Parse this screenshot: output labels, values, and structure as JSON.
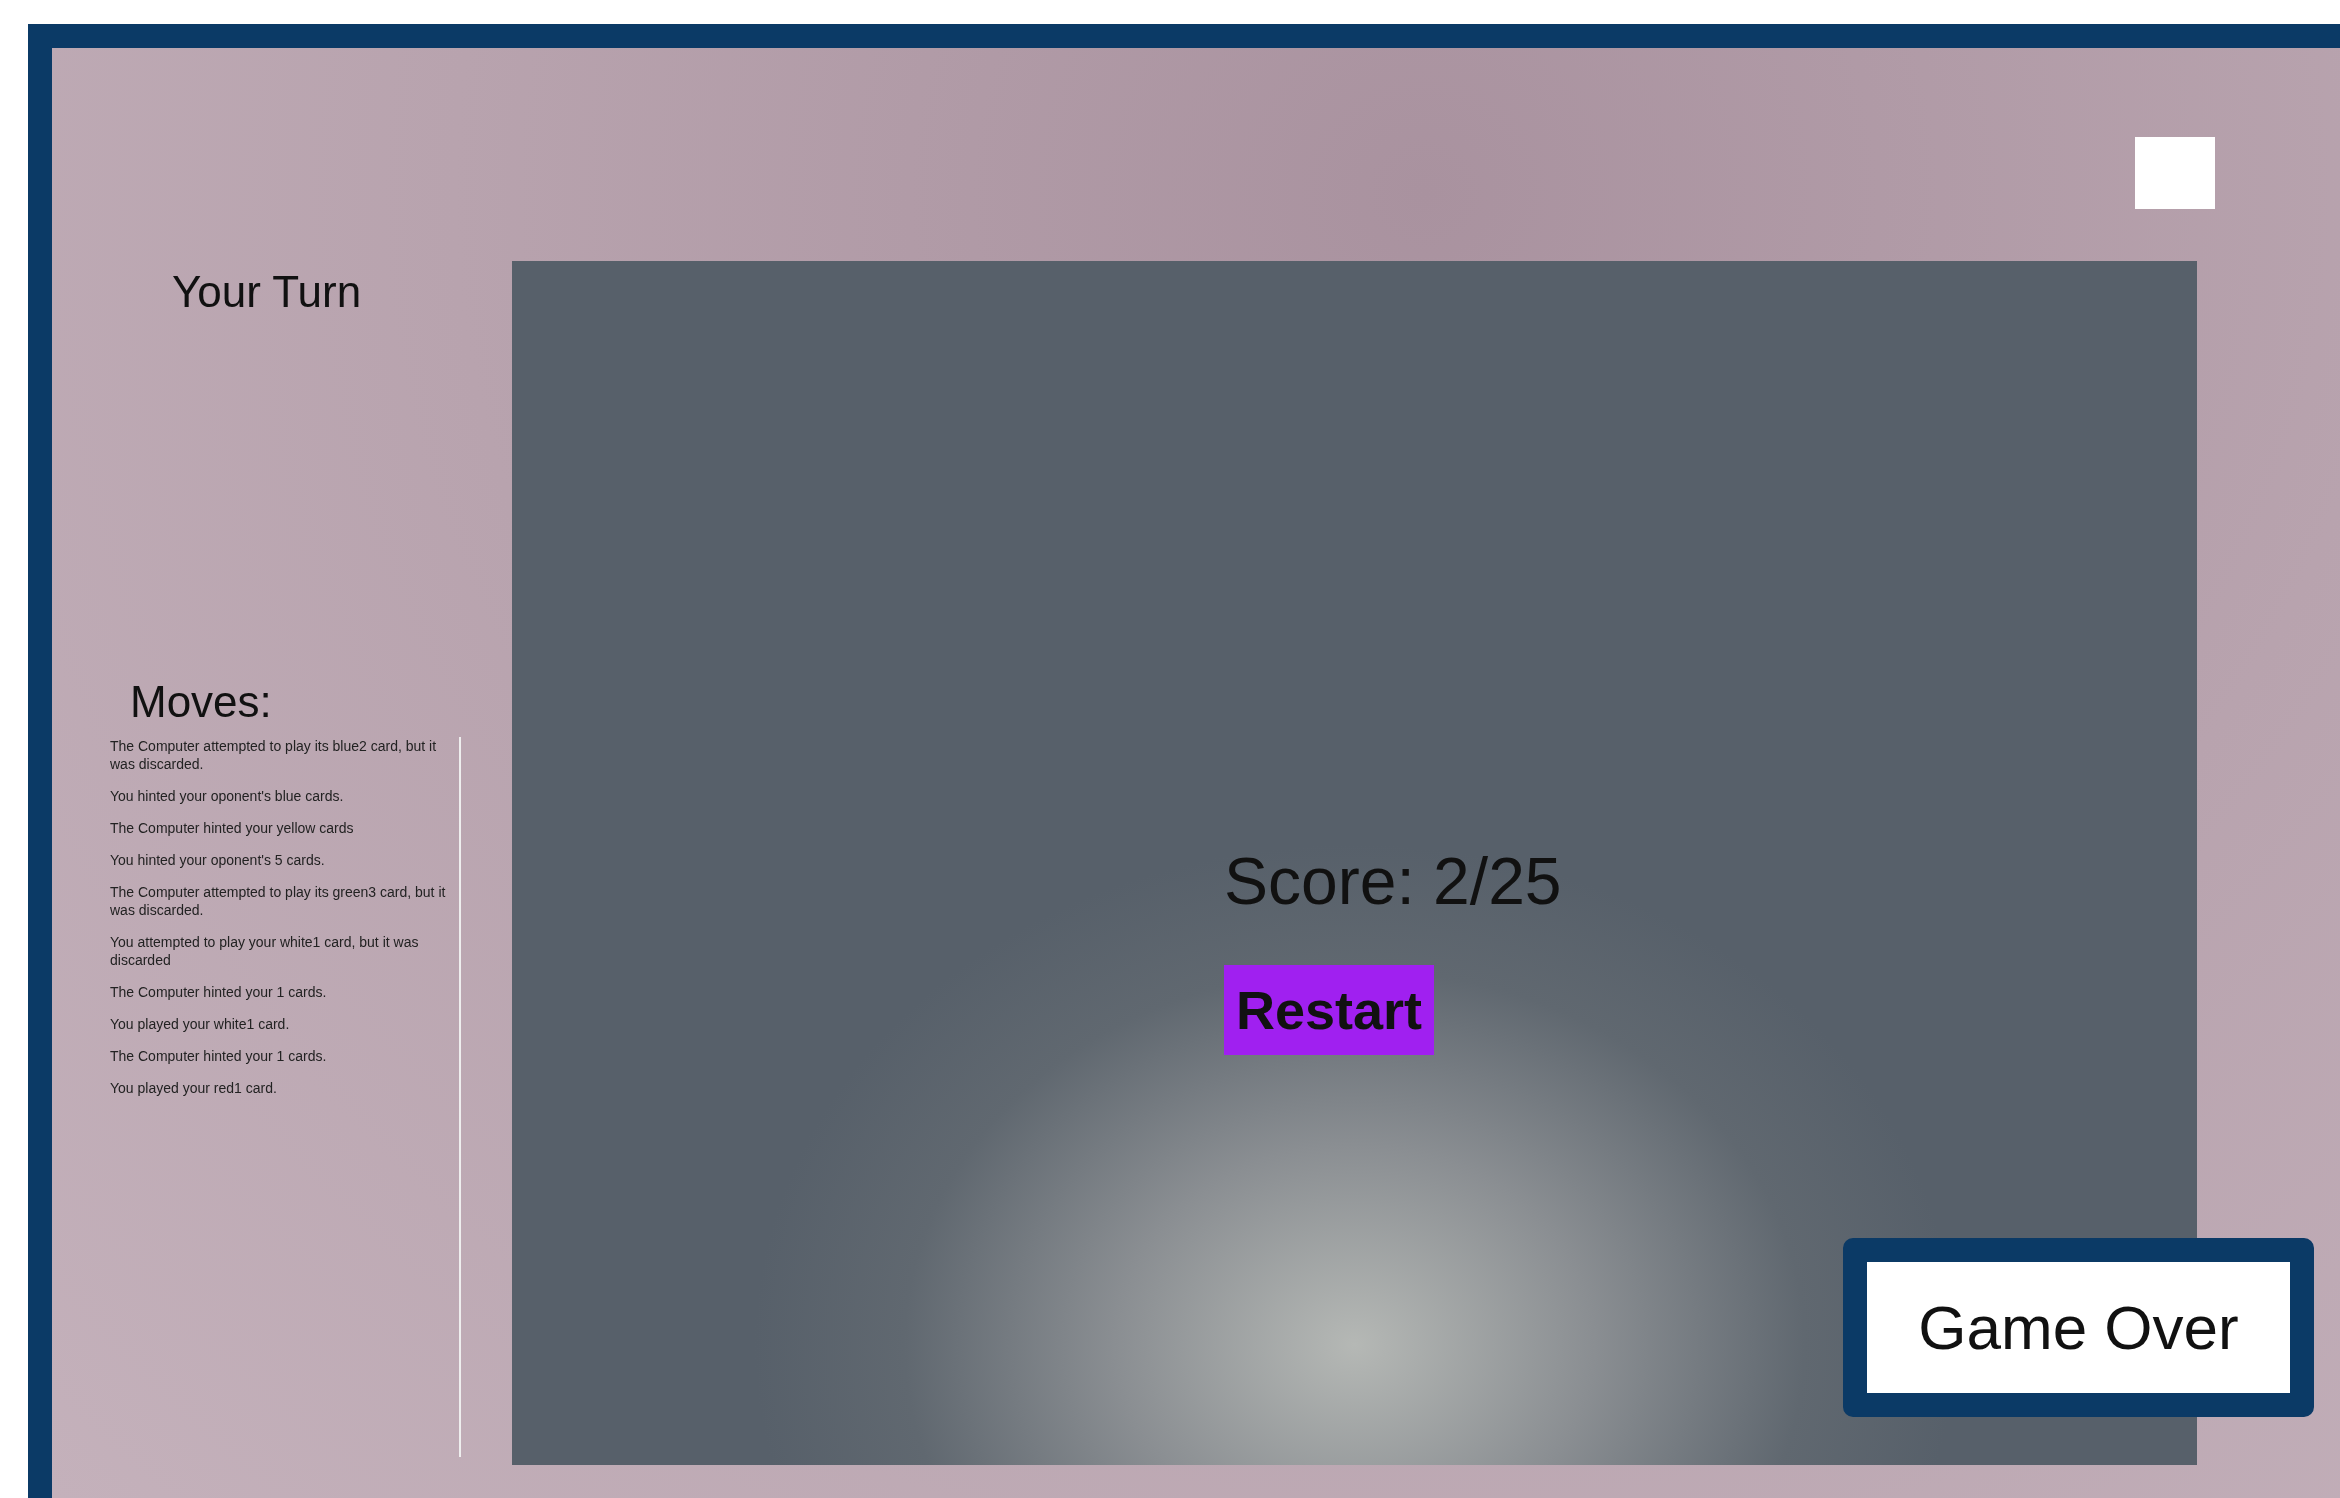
{
  "turn_label": "Your Turn",
  "moves": {
    "title": "Moves:",
    "items": [
      "The Computer attempted to play its blue2 card, but it was discarded.",
      "You hinted your oponent's blue cards.",
      "The Computer hinted your yellow cards",
      "You hinted your oponent's 5 cards.",
      "The Computer attempted to play its green3 card, but it was discarded.",
      "You attempted to play your white1 card, but it was discarded",
      "The Computer hinted your 1 cards.",
      "You played your white1 card.",
      "The Computer hinted your 1 cards.",
      "You played your red1 card."
    ]
  },
  "board": {
    "score": "Score: 2/25",
    "restart_button": "Restart"
  },
  "status": "Game Over"
}
